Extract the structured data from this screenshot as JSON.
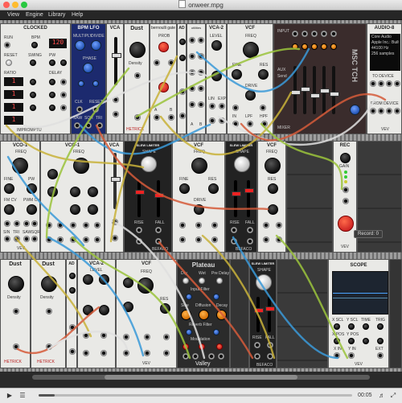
{
  "window": {
    "title": "onweer.mpg",
    "traffic_lights": [
      "#fe5f57",
      "#febc2e",
      "#28c840"
    ]
  },
  "menu": [
    {
      "label": "View"
    },
    {
      "label": "Engine"
    },
    {
      "label": "Library"
    },
    {
      "label": "Help"
    }
  ],
  "modules_row1": {
    "clocked": {
      "title": "CLOCKED",
      "display_bpm": "120",
      "displays": [
        "1",
        "1",
        "1",
        "1"
      ],
      "labels": [
        "RUN",
        "BPM",
        "RESET",
        "SWING",
        "RATIO",
        "DELAY",
        "PW",
        "IMPROMPTU"
      ],
      "footer": "IMPROMPTU"
    },
    "bpm_lfo": {
      "title": "BPM LFO",
      "labels": [
        "MULTIPLY",
        "DIVIDE",
        "PHASE",
        "CLK",
        "RESET",
        "SAW",
        "SQR",
        "TRI"
      ]
    },
    "vca_a": {
      "title": "VCA"
    },
    "dust_a": {
      "title": "Dust",
      "labels": [
        "Density"
      ],
      "footer": "HETRICK"
    },
    "bernoulli": {
      "title": "bernoulli gate",
      "labels": [
        "PROB",
        "IN",
        "A",
        "B"
      ]
    },
    "ad_a": {
      "title": "AD"
    },
    "utilities": {
      "title": "utilities",
      "labels": [
        "A",
        "B"
      ]
    },
    "vca2_a": {
      "title": "VCA-2",
      "labels": [
        "LEVEL",
        "LIN",
        "EXP"
      ]
    },
    "vcf_a": {
      "title": "VCF",
      "labels": [
        "FREQ",
        "FINE",
        "RES",
        "DRIVE",
        "FREQ CV",
        "FINE CV",
        "IN",
        "LPF",
        "HPF"
      ]
    },
    "mixer": {
      "title": "MSC TCH",
      "labels": [
        "INPUT",
        "AUX",
        "Send",
        "MIXER"
      ]
    },
    "audio8": {
      "title": "AUDIO-8",
      "screen_lines": [
        "Core Audio",
        "Apple Inc.: Built-in",
        "44100 Hz",
        "256 samples"
      ],
      "labels": [
        "TO DEVICE",
        "FROM DEVICE"
      ],
      "footer": "VEV"
    }
  },
  "modules_row2": {
    "vco1": {
      "title": "VCO-1",
      "labels": [
        "FREQ",
        "FINE",
        "PW",
        "FM CV",
        "PWM CV",
        "SIN",
        "TRI",
        "SAW",
        "SQR"
      ],
      "footer": "VEV"
    },
    "vco_b": {
      "title": "VCO-1",
      "labels": [
        "FREQ",
        "FINE",
        "PW"
      ]
    },
    "vca_b": {
      "title": "VCA"
    },
    "env_a": {
      "title": "SLEW LIMITER",
      "labels": [
        "SHAPE",
        "RISE",
        "FALL",
        "IN",
        "OUT"
      ],
      "footer": "BEFACO"
    },
    "vcf_b": {
      "title": "VCF",
      "labels": [
        "FREQ",
        "FINE",
        "RES",
        "DRIVE"
      ]
    },
    "env_b": {
      "title": "SLEW LIMITER",
      "labels": [
        "SHAPE",
        "RISE",
        "FALL",
        "IN",
        "OUT"
      ],
      "footer": "BEFACO"
    },
    "vcf_c": {
      "title": "VCF",
      "labels": [
        "FREQ",
        "RES"
      ]
    },
    "rec": {
      "title": "REC",
      "labels": [
        "GAIN",
        "LEFT",
        "RIGHT"
      ],
      "footer": "VEV"
    }
  },
  "record_label": "Record: 0",
  "modules_row3": {
    "dust_b": {
      "title": "Dust",
      "labels": [
        "Density"
      ],
      "footer": "HETRICK"
    },
    "dust_c": {
      "title": "Dust",
      "labels": [
        "Density"
      ],
      "footer": "HETRICK"
    },
    "ad_b": {
      "title": "AD"
    },
    "vca2_b": {
      "title": "VCA-2",
      "labels": [
        "LEVEL"
      ]
    },
    "vcf_d": {
      "title": "VCF",
      "labels": [
        "FREQ",
        "RES"
      ],
      "footer": "VEV"
    },
    "plateau": {
      "title": "Plateau",
      "labels": [
        "Dry",
        "Wet",
        "Pre Delay",
        "Input Filter",
        "Size",
        "Diffusion",
        "Decay",
        "Reverb Filter",
        "Tuned",
        "Modulation",
        "Rate",
        "Shape",
        "Depth"
      ],
      "footer": "Valley"
    },
    "slew_c": {
      "title": "SLEW LIMITER",
      "labels": [
        "SHAPE",
        "RISE",
        "FALL",
        "IN",
        "OUT"
      ],
      "footer": "BEFACO"
    },
    "scope": {
      "title": "SCOPE",
      "labels": [
        "X SCL",
        "Y SCL",
        "TIME",
        "TRIG",
        "X POS",
        "Y POS",
        "X IN",
        "Y IN",
        "EXT"
      ],
      "footer": "VEV"
    }
  },
  "player": {
    "time": "00:05",
    "progress_fraction": 0.05,
    "icons": [
      "play-icon",
      "list-icon",
      "volume-icon",
      "fullscreen-icon"
    ]
  }
}
